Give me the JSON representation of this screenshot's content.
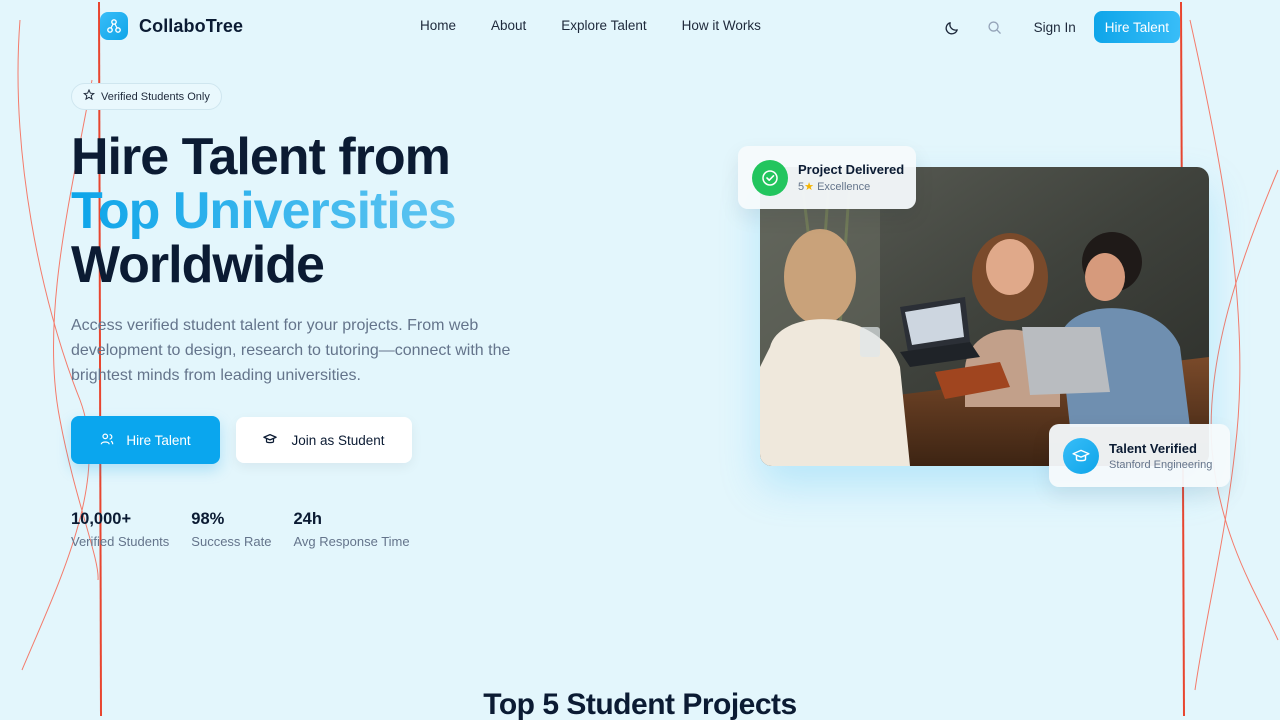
{
  "nav": {
    "brand": "CollaboTree",
    "links": [
      "Home",
      "About",
      "Explore Talent",
      "How it Works"
    ],
    "theme_icon": "moon-icon",
    "search_icon": "search-icon",
    "signin": "Sign In",
    "cta": "Hire Talent"
  },
  "hero": {
    "badge": "Verified Students Only",
    "title_line1": "Hire Talent from",
    "title_line2": "Top Universities",
    "title_line3": "Worldwide",
    "description": "Access verified student talent for your projects. From web development to design, research to tutoring—connect with the brightest minds from leading universities.",
    "primary_button": "Hire Talent",
    "secondary_button": "Join as Student",
    "stats": [
      {
        "value": "10,000+",
        "label": "Verified Students"
      },
      {
        "value": "98%",
        "label": "Success Rate"
      },
      {
        "value": "24h",
        "label": "Avg Response Time"
      }
    ]
  },
  "cards": {
    "delivered_title": "Project Delivered",
    "delivered_rating": "5",
    "delivered_sub": "Excellence",
    "verified_title": "Talent Verified",
    "verified_sub": "Stanford Engineering"
  },
  "next_section": {
    "title": "Top 5 Student Projects"
  },
  "colors": {
    "background": "#e3f6fc",
    "accent": "#0ea5e9",
    "success": "#22c55e",
    "text_dark": "#0b1b33",
    "text_muted": "#64748b"
  }
}
